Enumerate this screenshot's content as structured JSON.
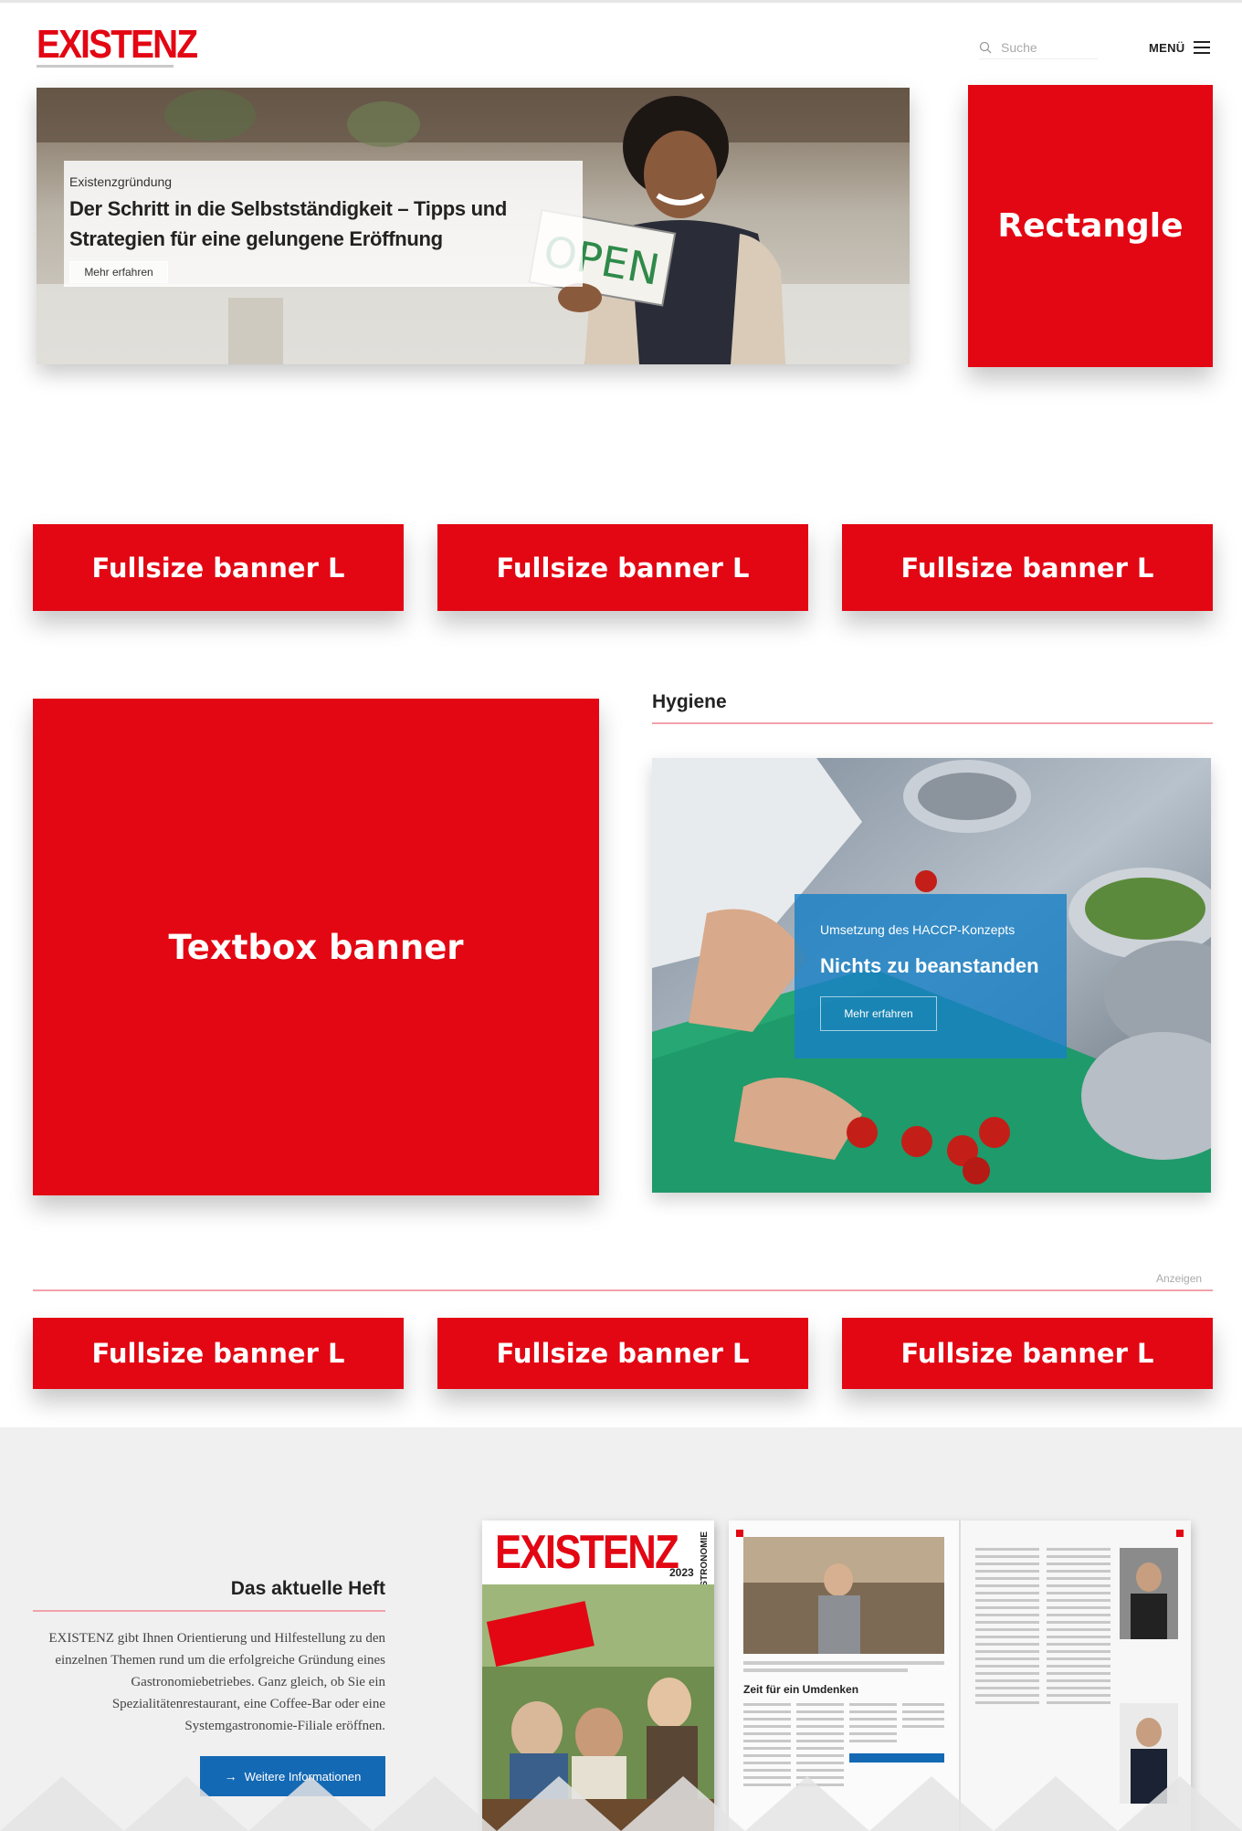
{
  "header": {
    "logo": "EXISTENZ",
    "search_placeholder": "Suche",
    "menu_label": "MENÜ"
  },
  "hero": {
    "kicker": "Existenzgründung",
    "title": "Der Schritt in die Selbstständigkeit – Tipps und Strategien für eine gelungene Eröffnung",
    "link": "Mehr erfahren",
    "sign_text": "OPEN"
  },
  "rectangle_banner": "Rectangle",
  "banners_row1": [
    "Fullsize banner L",
    "Fullsize banner L",
    "Fullsize banner L"
  ],
  "textbox_banner": "Textbox banner",
  "hygiene": {
    "section_title": "Hygiene",
    "kicker": "Umsetzung des HACCP-Konzepts",
    "title": "Nichts zu beanstanden",
    "link": "Mehr erfahren"
  },
  "ads_label": "Anzeigen",
  "banners_row2": [
    "Fullsize banner L",
    "Fullsize banner L",
    "Fullsize banner L"
  ],
  "issue": {
    "title": "Das aktuelle Heft",
    "text": "EXISTENZ gibt Ihnen Orientierung und Hilfestellung zu den einzelnen Themen rund um die erfolgreiche Gründung eines Gastronomiebetriebes. Ganz gleich, ob Sie ein Spezialitätenrestaurant, eine Coffee-Bar oder eine Systemgastronomie-Filiale eröffnen.",
    "button": "Weitere Informationen",
    "magazine_logo": "EXISTENZ",
    "magazine_year": "2023",
    "magazine_side": "GASTRONOMIE",
    "page_heading": "Zeit für ein Umdenken"
  },
  "colors": {
    "brand_red": "#e30613",
    "accent_blue": "#1469b4",
    "divider_pink": "#f2a2ab"
  }
}
